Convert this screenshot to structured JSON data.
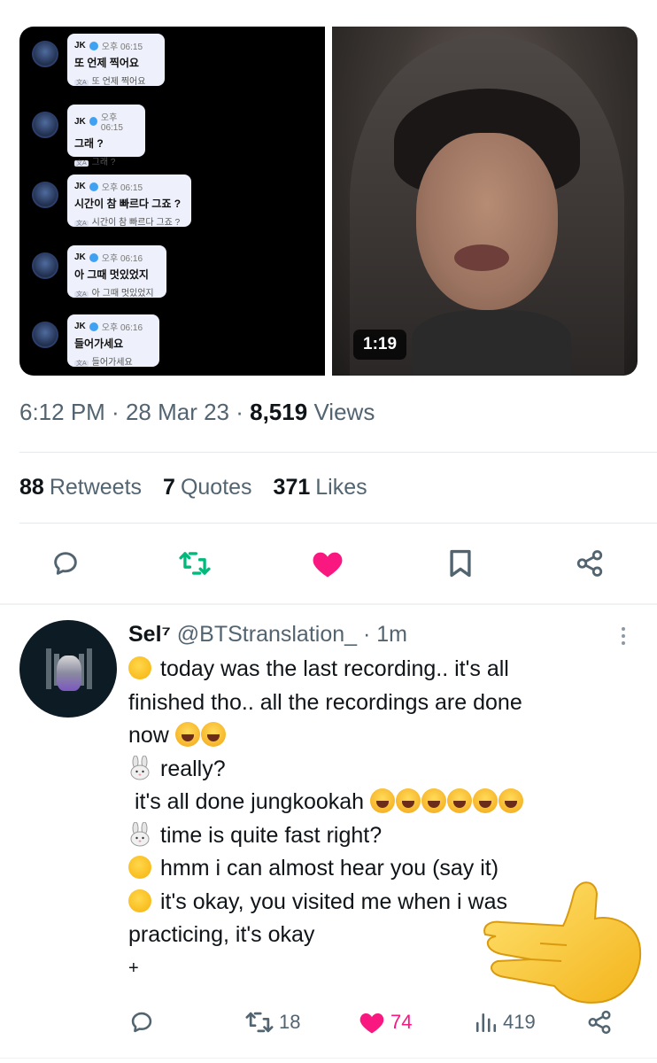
{
  "media": {
    "chat": [
      {
        "name": "JK",
        "time": "오후 06:15",
        "message": "또 언제 찍어요",
        "translation": "또 언제 찍어요"
      },
      {
        "name": "JK",
        "time": "오후 06:15",
        "message": "그래 ?",
        "translation": "그래 ?"
      },
      {
        "name": "JK",
        "time": "오후 06:15",
        "message": "시간이 참 빠르다 그죠 ?",
        "translation": "시간이 참 빠르다 그죠 ?"
      },
      {
        "name": "JK",
        "time": "오후 06:16",
        "message": "아 그때 멋있었지",
        "translation": "아 그때 멋있었지"
      },
      {
        "name": "JK",
        "time": "오후 06:16",
        "message": "들어가세요",
        "translation": "들어가세요"
      }
    ],
    "video_duration": "1:19"
  },
  "tweet_meta": {
    "time": "6:12 PM",
    "sep1": " · ",
    "date": "28 Mar 23",
    "sep2": " · ",
    "views_count": "8,519",
    "views_label": "Views"
  },
  "stats": {
    "retweets_count": "88",
    "retweets_label": "Retweets",
    "quotes_count": "7",
    "quotes_label": "Quotes",
    "likes_count": "371",
    "likes_label": "Likes"
  },
  "reply": {
    "display_name": "Sel⁷",
    "handle": "@BTStranslation_",
    "time": "· 1m",
    "lines": [
      "today was the last recording.. it's all",
      "finished tho.. all the recordings are done",
      "now",
      "really?",
      " it's all done jungkookah",
      "time is quite fast right?",
      "hmm i can almost hear you (say it)",
      "it's okay, you visited me when i was",
      "practicing, it's okay",
      "+"
    ],
    "retweets": "18",
    "likes": "74",
    "views": "419"
  },
  "colors": {
    "like": "#f91880",
    "retweet": "#00ba7c",
    "muted": "#536471"
  },
  "icons": {
    "reply": "comment-icon",
    "retweet": "retweet-icon",
    "like": "heart-icon",
    "bookmark": "bookmark-icon",
    "share": "share-icon",
    "views": "analytics-icon",
    "more": "more-icon"
  }
}
